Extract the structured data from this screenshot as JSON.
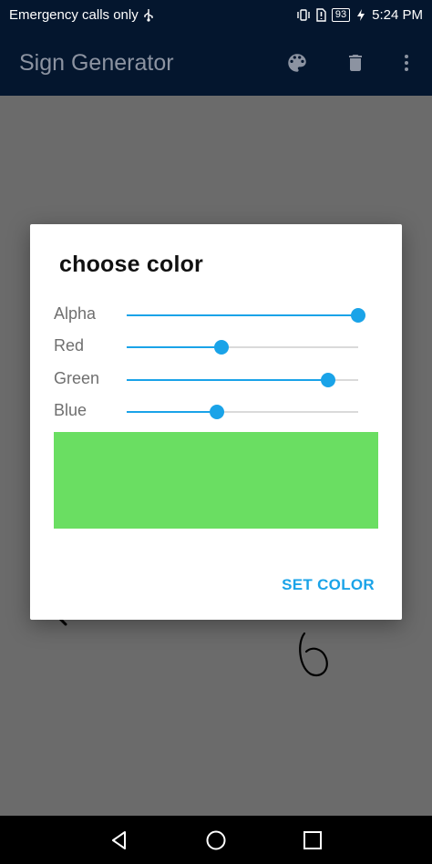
{
  "status_bar": {
    "carrier_text": "Emergency calls only",
    "battery": "93",
    "time": "5:24 PM",
    "icons": [
      "usb-icon",
      "vibrate-icon",
      "sim-alert-icon",
      "battery-icon",
      "charging-icon"
    ]
  },
  "app_bar": {
    "title": "Sign Generator",
    "actions": [
      "palette-icon",
      "delete-icon",
      "more-vert-icon"
    ]
  },
  "dialog": {
    "title": "choose color",
    "sliders": [
      {
        "label": "Alpha",
        "value": 255,
        "max": 255,
        "fraction": 1.0
      },
      {
        "label": "Red",
        "value": 106,
        "max": 255,
        "fraction": 0.41
      },
      {
        "label": "Green",
        "value": 221,
        "max": 255,
        "fraction": 0.87
      },
      {
        "label": "Blue",
        "value": 98,
        "max": 255,
        "fraction": 0.39
      }
    ],
    "preview_color": "#6ade62",
    "set_button": "SET COLOR"
  },
  "colors": {
    "accent": "#1aa3e8",
    "app_bar": "#04162e",
    "scrim": "#6b6b6b"
  },
  "nav_bar": {
    "buttons": [
      "back-icon",
      "home-icon",
      "recents-icon"
    ]
  }
}
